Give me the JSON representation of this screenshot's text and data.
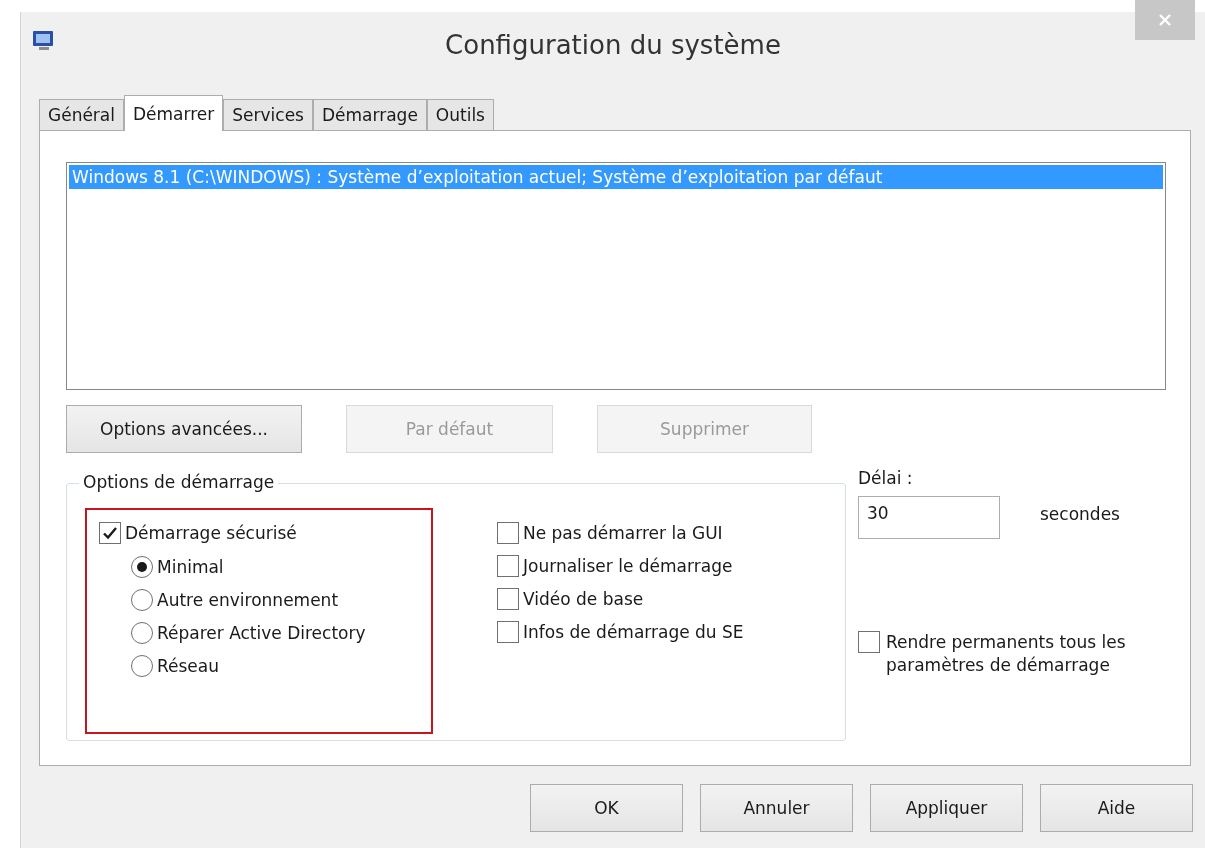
{
  "window": {
    "title": "Configuration du système"
  },
  "tabs": [
    {
      "label": "Général",
      "selected": false
    },
    {
      "label": "Démarrer",
      "selected": true
    },
    {
      "label": "Services",
      "selected": false
    },
    {
      "label": "Démarrage",
      "selected": false
    },
    {
      "label": "Outils",
      "selected": false
    }
  ],
  "boot_list": [
    {
      "label": "Windows 8.1 (C:\\WINDOWS) : Système d’exploitation actuel; Système d’exploitation par défaut",
      "selected": true
    }
  ],
  "list_buttons": [
    {
      "label": "Options avancées...",
      "disabled": false
    },
    {
      "label": "Par défaut",
      "disabled": true
    },
    {
      "label": "Supprimer",
      "disabled": true
    }
  ],
  "boot_options": {
    "title": "Options de démarrage",
    "safe_boot": {
      "label": "Démarrage sécurisé",
      "checked": true,
      "highlighted": true,
      "modes": [
        {
          "label": "Minimal",
          "selected": true
        },
        {
          "label": "Autre environnement",
          "selected": false
        },
        {
          "label": "Réparer Active Directory",
          "selected": false
        },
        {
          "label": "Réseau",
          "selected": false
        }
      ]
    },
    "checkboxes": [
      {
        "label": "Ne pas démarrer la GUI",
        "checked": false
      },
      {
        "label": "Journaliser le démarrage",
        "checked": false
      },
      {
        "label": "Vidéo de base",
        "checked": false
      },
      {
        "label": "Infos de démarrage du SE",
        "checked": false
      }
    ]
  },
  "timeout": {
    "label": "Délai :",
    "value": "30",
    "unit": "secondes"
  },
  "permanent": {
    "label": "Rendre permanents tous les paramètres de démarrage",
    "checked": false
  },
  "buttons": [
    {
      "label": "OK"
    },
    {
      "label": "Annuler"
    },
    {
      "label": "Appliquer"
    },
    {
      "label": "Aide"
    }
  ]
}
